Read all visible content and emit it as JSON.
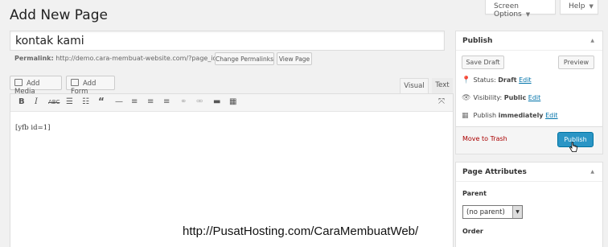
{
  "header": {
    "title": "Add New Page",
    "screen_options": "Screen Options",
    "help": "Help"
  },
  "editor": {
    "title_value": "kontak kami",
    "permalink_label": "Permalink:",
    "permalink_url": "http://demo.cara-membuat-website.com/?page_id=6",
    "change_permalinks": "Change Permalinks",
    "view_page": "View Page",
    "add_media": "Add Media",
    "add_form": "Add Form",
    "tab_visual": "Visual",
    "tab_text": "Text",
    "content": "[yfb id=1]",
    "toolbar_icons": [
      "bold-icon",
      "italic-icon",
      "strikethrough-icon",
      "bullet-list-icon",
      "numbered-list-icon",
      "blockquote-icon",
      "horizontal-rule-icon",
      "align-left-icon",
      "align-center-icon",
      "align-right-icon",
      "link-icon",
      "unlink-icon",
      "read-more-icon",
      "toolbar-toggle-icon",
      "fullscreen-icon"
    ]
  },
  "publish": {
    "title": "Publish",
    "save_draft": "Save Draft",
    "preview": "Preview",
    "status_label": "Status:",
    "status_value": "Draft",
    "visibility_label": "Visibility:",
    "visibility_value": "Public",
    "schedule_label": "Publish",
    "schedule_value": "immediately",
    "edit": "Edit",
    "move_to_trash": "Move to Trash",
    "publish_button": "Publish",
    "accent": "#2a95c5"
  },
  "attributes": {
    "title": "Page Attributes",
    "parent_label": "Parent",
    "parent_value": "(no parent)",
    "order_label": "Order"
  },
  "watermark": "http://PusatHosting.com/CaraMembuatWeb/"
}
